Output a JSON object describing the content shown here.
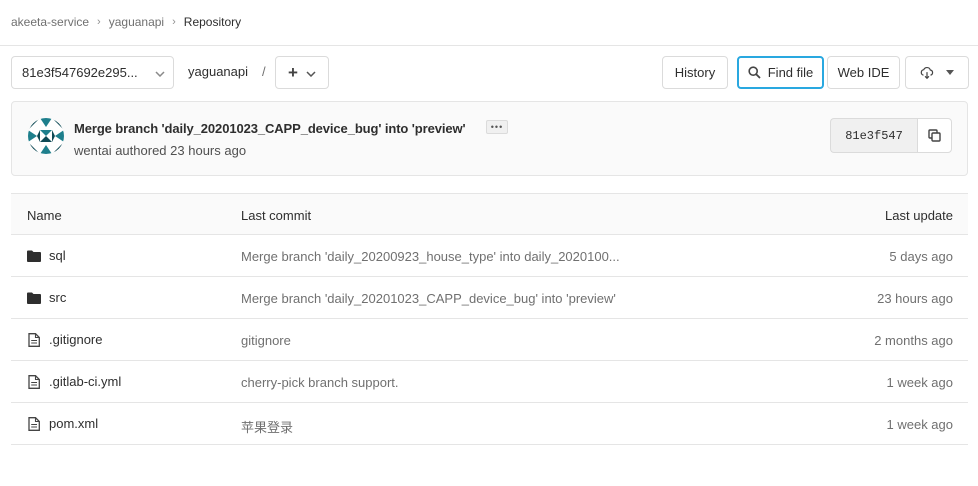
{
  "breadcrumb": {
    "items": [
      "akeeta-service",
      "yaguanapi",
      "Repository"
    ]
  },
  "toolbar": {
    "ref": "81e3f547692e295...",
    "path_root": "yaguanapi",
    "path_sep": "/",
    "add_label": "+",
    "history_label": "History",
    "find_file_label": "Find file",
    "web_ide_label": "Web IDE"
  },
  "commit": {
    "title": "Merge branch 'daily_20201023_CAPP_device_bug' into 'preview'",
    "ellipsis": "•••",
    "author": "wentai",
    "authored": "authored",
    "time": "23 hours ago",
    "sha": "81e3f547"
  },
  "table": {
    "headers": {
      "name": "Name",
      "last_commit": "Last commit",
      "last_update": "Last update"
    },
    "rows": [
      {
        "type": "folder",
        "name": "sql",
        "commit": "Merge branch 'daily_20200923_house_type' into daily_2020100...",
        "date": "5 days ago"
      },
      {
        "type": "folder",
        "name": "src",
        "commit": "Merge branch 'daily_20201023_CAPP_device_bug' into 'preview'",
        "date": "23 hours ago"
      },
      {
        "type": "file",
        "name": ".gitignore",
        "commit": "gitignore",
        "date": "2 months ago"
      },
      {
        "type": "file",
        "name": ".gitlab-ci.yml",
        "commit": "cherry-pick branch support.",
        "date": "1 week ago"
      },
      {
        "type": "file",
        "name": "pom.xml",
        "commit": "苹果登录",
        "date": "1 week ago"
      }
    ]
  },
  "colors": {
    "focus_border": "#29a8e0",
    "avatar_teal": "#1e7f8c",
    "avatar_dark": "#0e4a55"
  },
  "icons": {
    "folder": "folder-icon",
    "file": "file-icon",
    "search": "search-icon",
    "copy": "copy-icon",
    "download": "download-icon",
    "chevron": "chevron-down-icon"
  }
}
